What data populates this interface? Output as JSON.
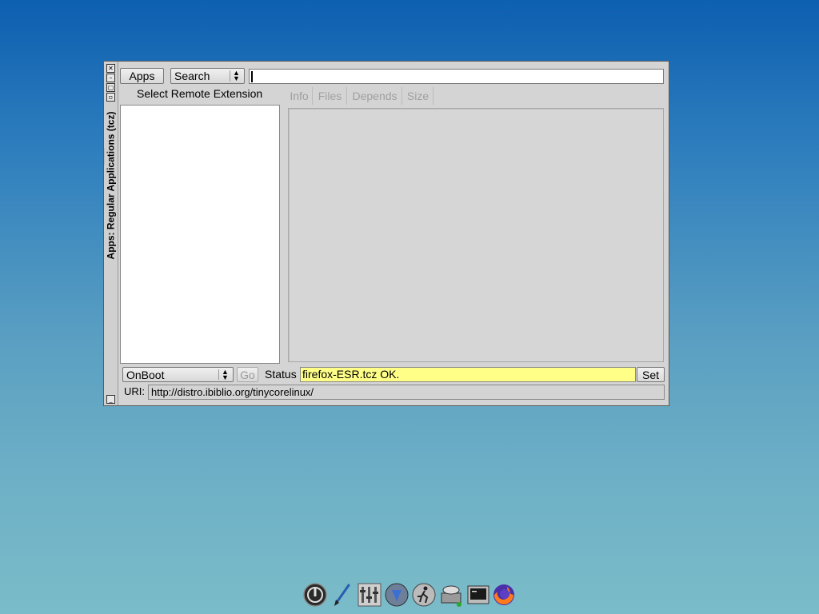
{
  "window": {
    "title": "Apps: Regular Applications (tcz)",
    "titlebar_buttons": [
      "close",
      "minimize",
      "maximize",
      "restore",
      "shade"
    ]
  },
  "toolbar": {
    "apps_label": "Apps",
    "search_mode": "Search",
    "search_value": ""
  },
  "left_panel": {
    "header": "Select Remote Extension",
    "items": []
  },
  "tabs": [
    {
      "label": "Info",
      "enabled": false
    },
    {
      "label": "Files",
      "enabled": false
    },
    {
      "label": "Depends",
      "enabled": false
    },
    {
      "label": "Size",
      "enabled": false
    }
  ],
  "bottom": {
    "install_mode": "OnBoot",
    "go_label": "Go",
    "status_label": "Status",
    "status_value": "firefox-ESR.tcz OK.",
    "set_label": "Set",
    "uri_label": "URI:",
    "uri_value": "http://distro.ibiblio.org/tinycorelinux/"
  },
  "colors": {
    "status_background": "#ffff88",
    "window_background": "#d4d4d4"
  },
  "dock": {
    "icons": [
      "power-icon",
      "paint-brush-icon",
      "control-panel-icon",
      "apps-download-icon",
      "run-icon",
      "mount-tool-icon",
      "terminal-icon",
      "firefox-icon"
    ]
  }
}
